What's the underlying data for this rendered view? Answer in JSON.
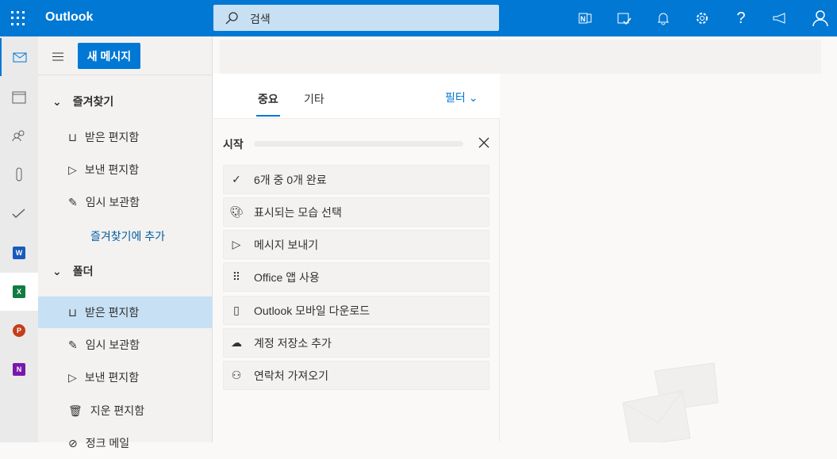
{
  "header": {
    "brand": "Outlook",
    "search_placeholder": "검색",
    "icons": [
      "onenote-feed-icon",
      "my-day-icon",
      "bell-icon",
      "gear-icon",
      "help-icon",
      "megaphone-icon",
      "account-icon"
    ]
  },
  "rail": {
    "items": [
      "mail-icon",
      "calendar-icon",
      "people-icon",
      "attachment-icon",
      "todo-icon",
      "word-icon",
      "excel-icon",
      "powerpoint-icon",
      "onenote-icon"
    ]
  },
  "folders": {
    "new_message": "새 메시지",
    "favorites_title": "즐겨찾기",
    "favorites": [
      {
        "label": "받은 편지함",
        "icon": "inbox-icon"
      },
      {
        "label": "보낸 편지함",
        "icon": "send-icon"
      },
      {
        "label": "임시 보관함",
        "icon": "pencil-icon"
      }
    ],
    "add_favorite": "즐겨찾기에 추가",
    "folders_title": "폴더",
    "items": [
      {
        "label": "받은 편지함",
        "icon": "inbox-icon",
        "selected": true
      },
      {
        "label": "임시 보관함",
        "icon": "pencil-icon"
      },
      {
        "label": "보낸 편지함",
        "icon": "send-icon"
      },
      {
        "label": "지운 편지함",
        "icon": "trash-icon"
      },
      {
        "label": "정크 메일",
        "icon": "junk-icon"
      }
    ]
  },
  "list": {
    "tabs": [
      "중요",
      "기타"
    ],
    "filter": "필터"
  },
  "getting_started": {
    "title": "시작",
    "progress": 0,
    "items": [
      {
        "label": "6개 중 0개 완료",
        "icon": "check-icon"
      },
      {
        "label": "표시되는 모습 선택",
        "icon": "palette-icon"
      },
      {
        "label": "메시지 보내기",
        "icon": "send-icon"
      },
      {
        "label": "Office 앱 사용",
        "icon": "apps-icon"
      },
      {
        "label": "Outlook 모바일 다운로드",
        "icon": "phone-icon"
      },
      {
        "label": "계정 저장소 추가",
        "icon": "cloud-icon"
      },
      {
        "label": "연락처 가져오기",
        "icon": "people-icon"
      }
    ]
  },
  "colors": {
    "accent": "#0078d4",
    "selected": "#c7e0f4"
  }
}
